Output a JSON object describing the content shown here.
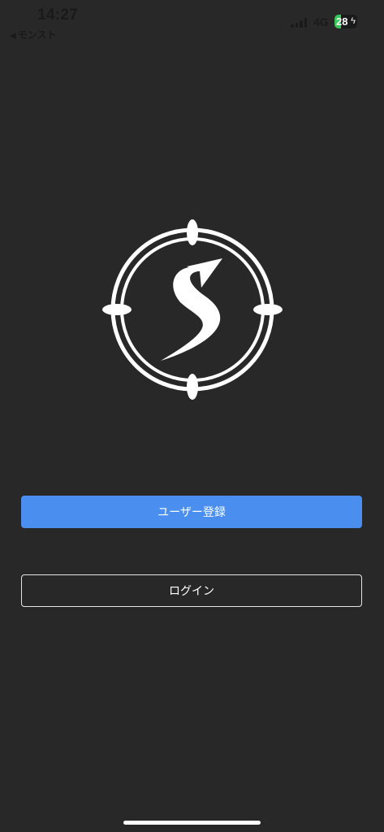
{
  "status_bar": {
    "time": "14:27",
    "back_app": "モンスト",
    "network": "4G",
    "battery_level": "28",
    "battery_fraction": 0.28
  },
  "logo": {
    "icon": "compass-s-logo"
  },
  "buttons": {
    "register_label": "ユーザー登録",
    "login_label": "ログイン"
  },
  "colors": {
    "background": "#282828",
    "primary": "#4a8ff0",
    "battery": "#35c759"
  }
}
